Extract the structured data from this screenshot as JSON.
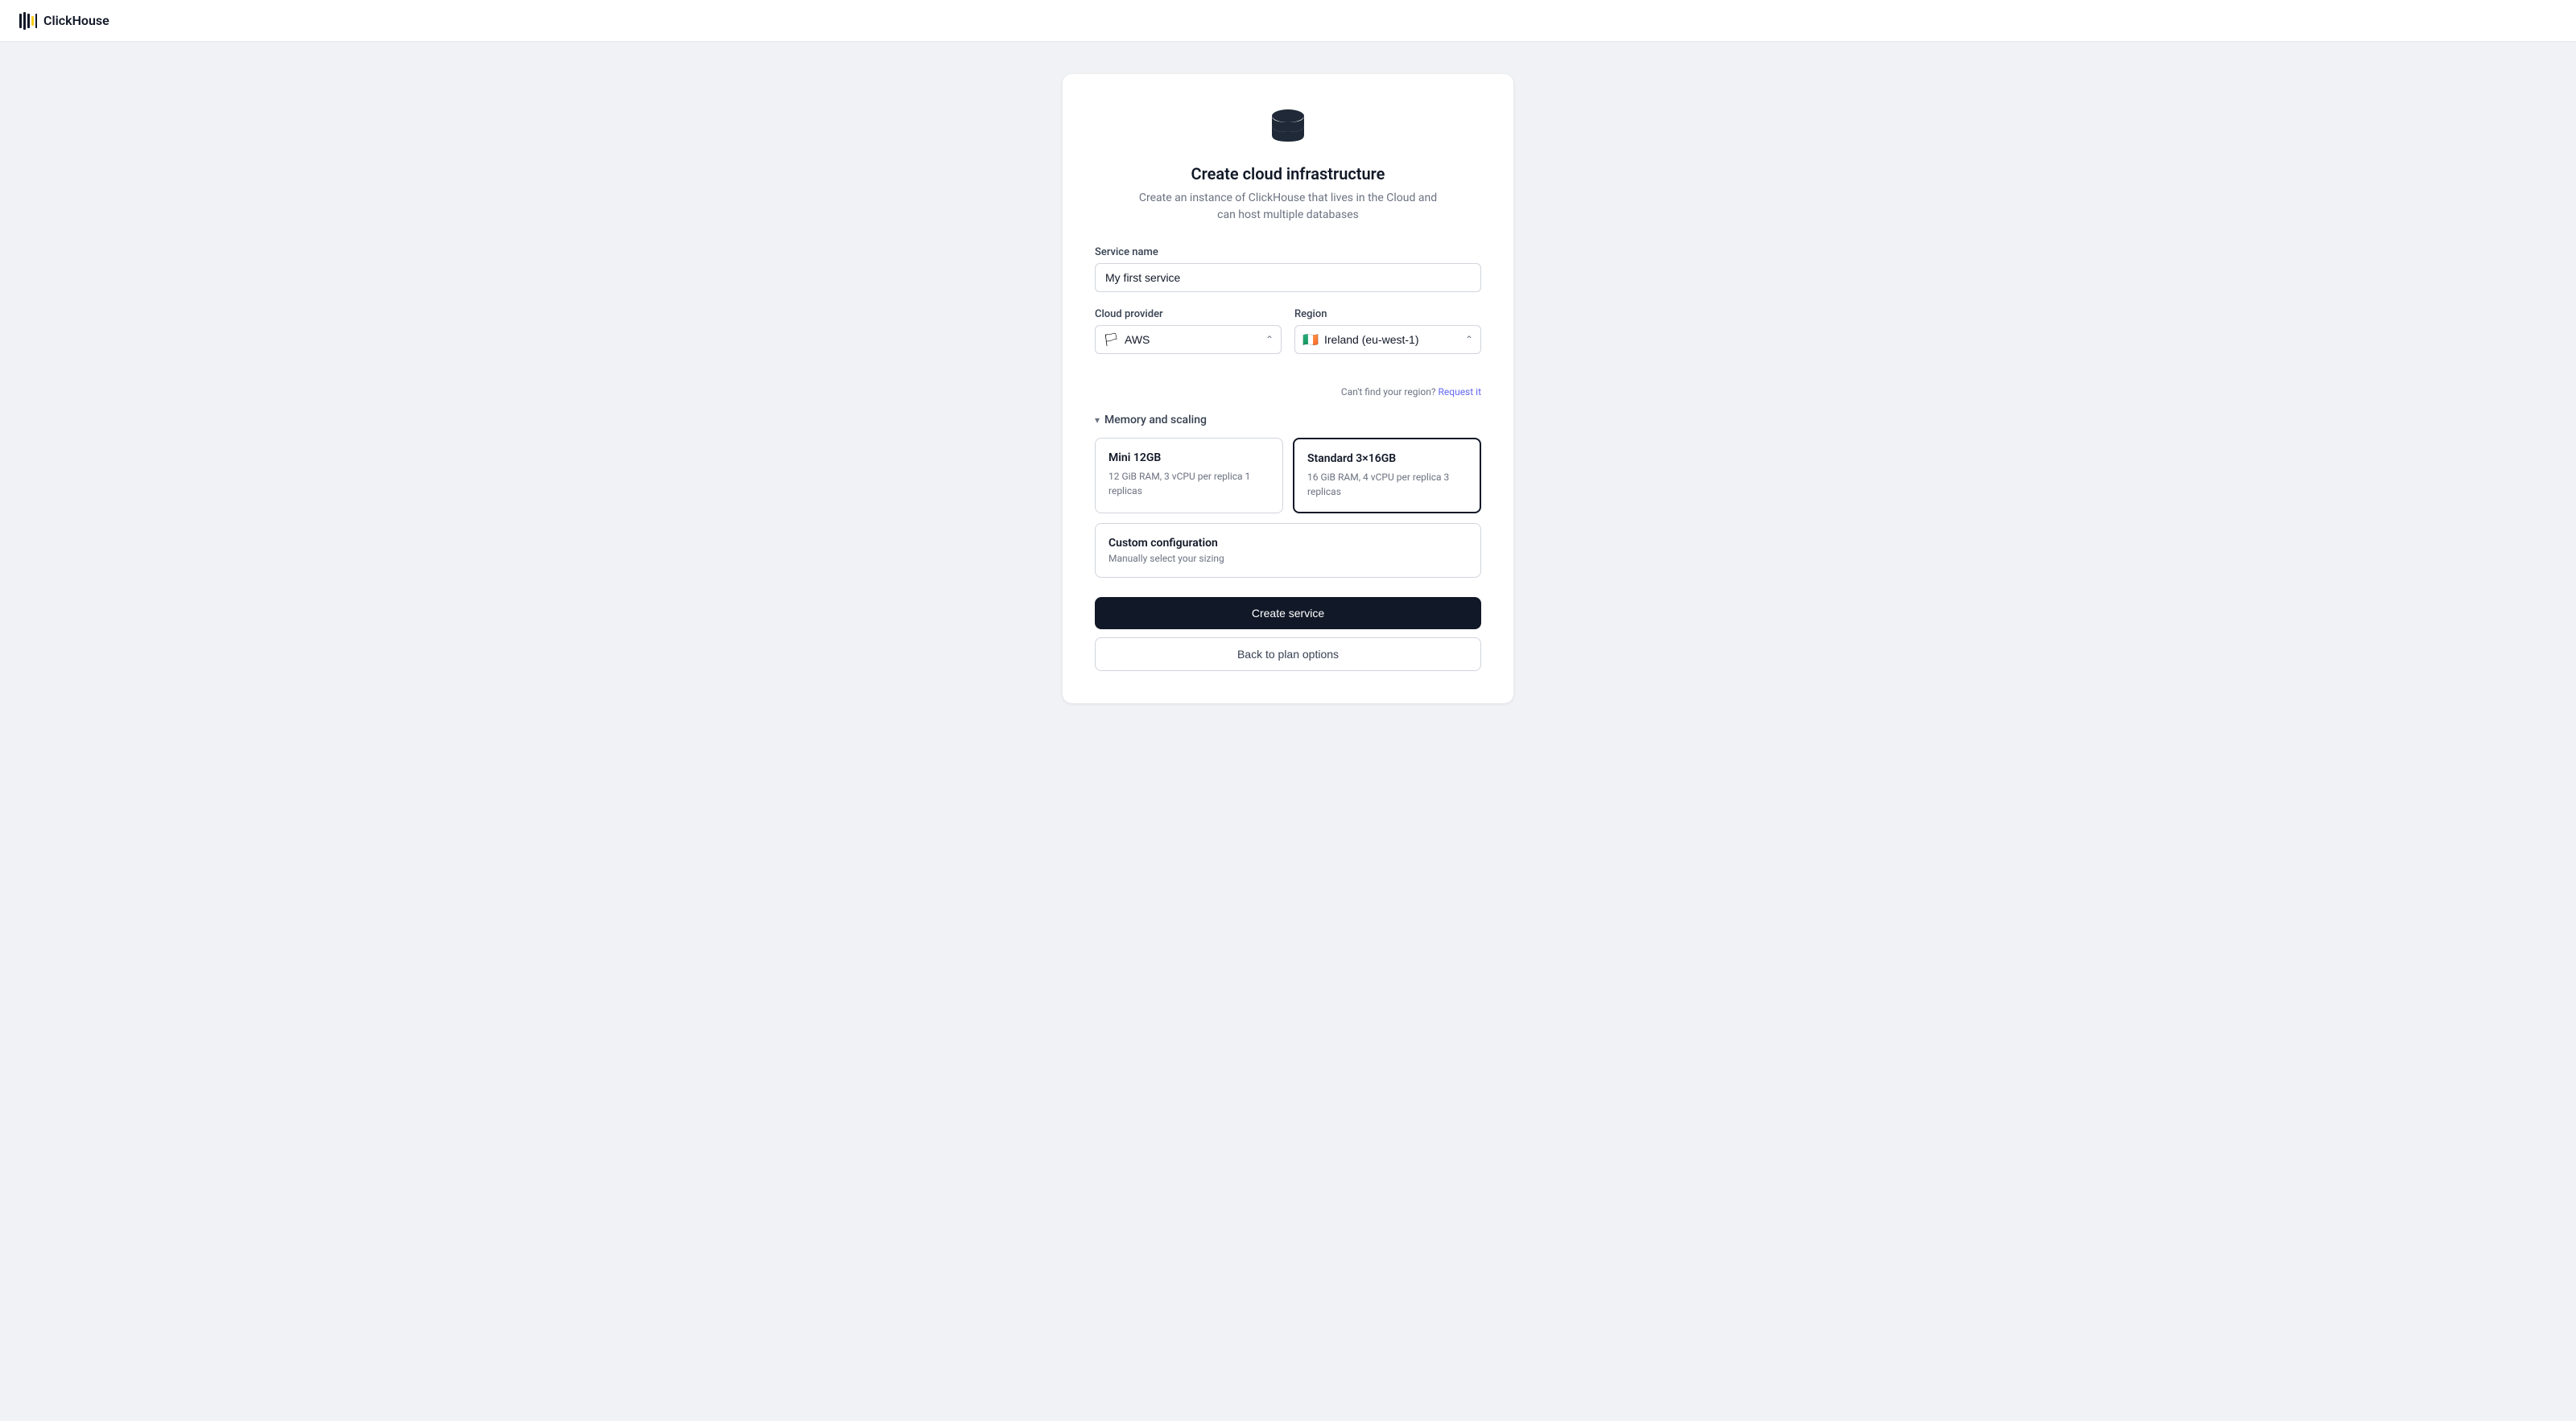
{
  "navbar": {
    "logo_text": "ClickHouse",
    "logo_icon": "clickhouse-logo"
  },
  "page": {
    "icon": "database-icon",
    "title": "Create cloud infrastructure",
    "subtitle": "Create an instance of ClickHouse that lives in the Cloud and\ncan host multiple databases"
  },
  "form": {
    "service_name_label": "Service name",
    "service_name_value": "My first service",
    "service_name_placeholder": "My first service",
    "cloud_provider_label": "Cloud provider",
    "cloud_provider_value": "AWS",
    "cloud_provider_flag": "🏳",
    "region_label": "Region",
    "region_value": "Ireland (eu-west-1)",
    "region_flag": "🇮🇪",
    "region_note": "Can't find your region?",
    "region_link": "Request it"
  },
  "memory_scaling": {
    "section_label": "Memory and scaling",
    "plans": [
      {
        "id": "mini",
        "name": "Mini 12GB",
        "description": "12 GiB RAM, 3 vCPU per replica 1 replicas",
        "selected": false
      },
      {
        "id": "standard",
        "name": "Standard 3×16GB",
        "description": "16 GiB RAM, 4 vCPU per replica 3 replicas",
        "selected": true
      }
    ],
    "custom": {
      "name": "Custom configuration",
      "description": "Manually select your sizing"
    }
  },
  "actions": {
    "create_label": "Create service",
    "back_label": "Back to plan options"
  }
}
